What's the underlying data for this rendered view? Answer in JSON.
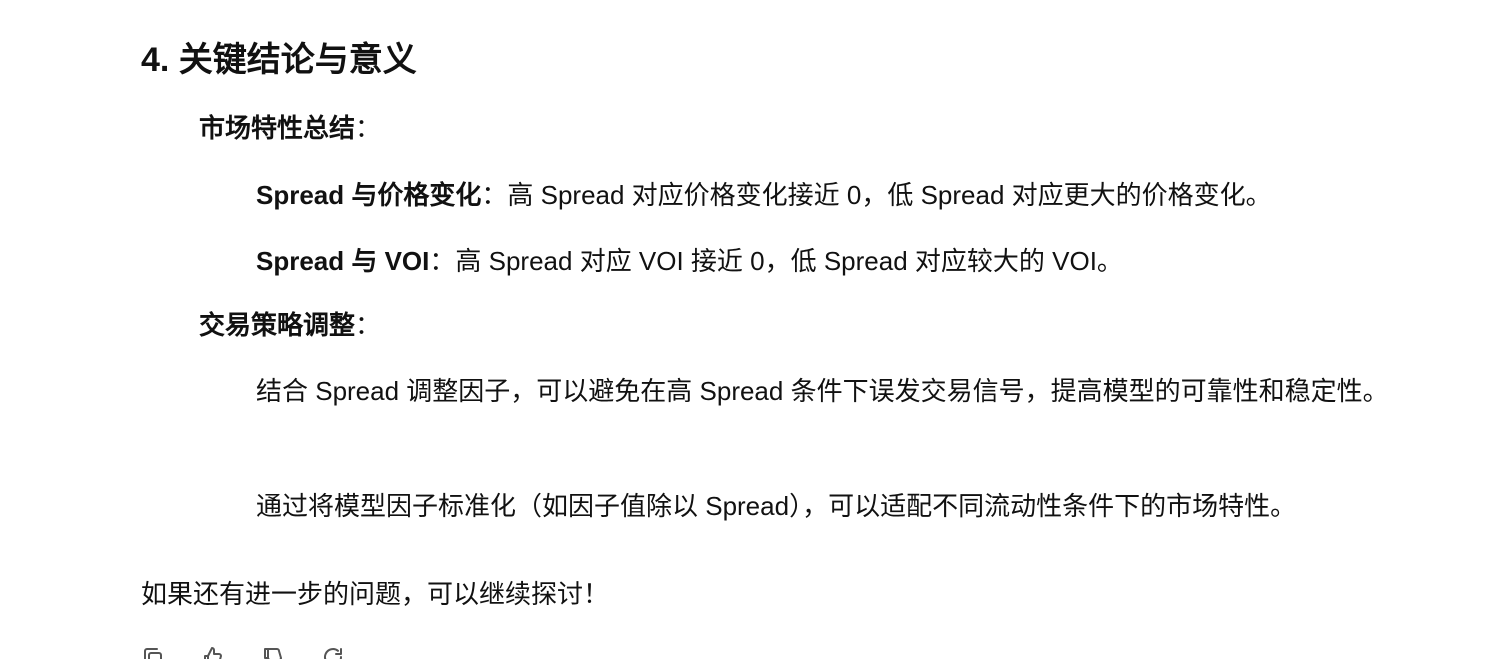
{
  "section": {
    "heading": "4. 关键结论与意义"
  },
  "market": {
    "label": "市场特性总结",
    "colon": "：",
    "items": [
      {
        "term": "Spread 与价格变化",
        "sep": "：",
        "text": "高 Spread 对应价格变化接近 0，低 Spread 对应更大的价格变化。"
      },
      {
        "term": "Spread 与 VOI",
        "sep": "：",
        "text": "高 Spread 对应 VOI 接近 0，低 Spread 对应较大的 VOI。"
      }
    ]
  },
  "strategy": {
    "label": "交易策略调整",
    "colon": "：",
    "items": [
      {
        "text": "结合 Spread 调整因子，可以避免在高 Spread 条件下误发交易信号，提高模型的可靠性和稳定性。"
      },
      {
        "text": "通过将模型因子标准化（如因子值除以 Spread），可以适配不同流动性条件下的市场特性。"
      }
    ]
  },
  "closing": {
    "text": "如果还有进一步的问题，可以继续探讨！"
  },
  "toolbar": {
    "icons": [
      "copy-icon",
      "thumbs-up-icon",
      "thumbs-down-icon",
      "regenerate-icon"
    ]
  }
}
